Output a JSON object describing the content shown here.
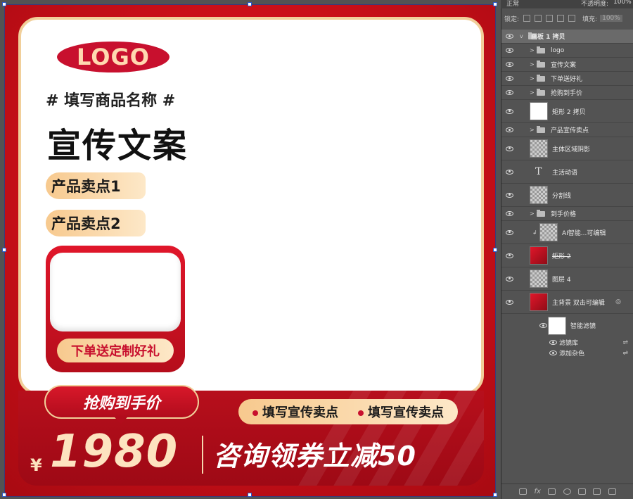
{
  "toolbar": {
    "blend_mode": "正常",
    "opacity_label": "不透明度:",
    "opacity_value": "100%",
    "lock_label": "锁定:",
    "fill_label": "填充:",
    "fill_value": "100%"
  },
  "design": {
    "logo": "LOGO",
    "product_name": "# 填写商品名称 #",
    "slogan": "宣传文案",
    "selling_point_1": "产品卖点1",
    "selling_point_2": "产品卖点2",
    "gift_label": "下单送定制好礼",
    "grab_price_label": "抢购到手价",
    "promo_1": "填写宣传卖点",
    "promo_2": "填写宣传卖点",
    "currency": "¥",
    "price": "1980",
    "coupon": "咨询领券立减50"
  },
  "layers": [
    {
      "name": "画板 1 拷贝",
      "kind": "artboard"
    },
    {
      "name": "logo",
      "kind": "group"
    },
    {
      "name": "宣传文案",
      "kind": "group"
    },
    {
      "name": "下单送好礼",
      "kind": "group"
    },
    {
      "name": "抢购到手价",
      "kind": "group"
    },
    {
      "name": "矩形 2 拷贝",
      "kind": "shape"
    },
    {
      "name": "产品宣传卖点",
      "kind": "group"
    },
    {
      "name": "主体区域阴影",
      "kind": "raster"
    },
    {
      "name": "主活动语",
      "kind": "text"
    },
    {
      "name": "分割线",
      "kind": "smart"
    },
    {
      "name": "到手价格",
      "kind": "group"
    },
    {
      "name": "AI智能...可编辑",
      "kind": "smart"
    },
    {
      "name": "矩形 2",
      "kind": "shape"
    },
    {
      "name": "图层 4",
      "kind": "raster"
    },
    {
      "name": "主背景 双击可编辑",
      "kind": "smart"
    },
    {
      "name": "智能滤镜",
      "kind": "filter-mask"
    },
    {
      "name": "滤镜库",
      "kind": "filter"
    },
    {
      "name": "添加杂色",
      "kind": "filter"
    }
  ],
  "footer_icons": [
    "link-icon",
    "fx-icon",
    "mask-icon",
    "adjustment-icon",
    "folder-icon",
    "new-layer-icon",
    "trash-icon"
  ]
}
